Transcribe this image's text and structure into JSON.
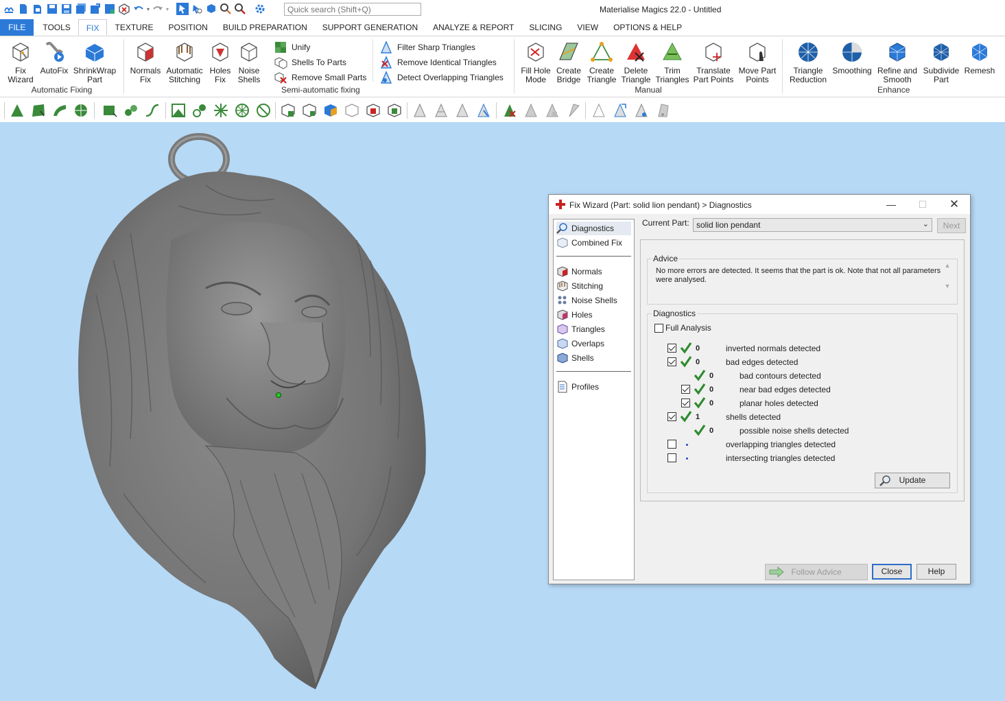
{
  "app": {
    "title": "Materialise Magics 22.0 - Untitled",
    "quick_search_placeholder": "Quick search (Shift+Q)"
  },
  "menu": {
    "tabs": [
      "FILE",
      "TOOLS",
      "FIX",
      "TEXTURE",
      "POSITION",
      "BUILD PREPARATION",
      "SUPPORT GENERATION",
      "ANALYZE & REPORT",
      "SLICING",
      "VIEW",
      "OPTIONS & HELP"
    ],
    "active": "FIX"
  },
  "ribbon": {
    "automatic_fixing": {
      "label": "Automatic Fixing",
      "fix_wizard": [
        "Fix",
        "Wizard"
      ],
      "autofix": "AutoFix",
      "shrinkwrap": [
        "ShrinkWrap",
        "Part"
      ]
    },
    "semi": {
      "label": "Semi-automatic fixing",
      "normals_fix": [
        "Normals",
        "Fix"
      ],
      "auto_stitch": [
        "Automatic",
        "Stitching"
      ],
      "holes_fix": [
        "Holes",
        "Fix"
      ],
      "noise_shells": [
        "Noise",
        "Shells"
      ],
      "unify": "Unify",
      "shells_to_parts": "Shells To Parts",
      "remove_small_parts": "Remove Small Parts",
      "filter_sharp": "Filter Sharp Triangles",
      "remove_identical": "Remove Identical Triangles",
      "detect_overlapping": "Detect Overlapping Triangles"
    },
    "manual": {
      "label": "Manual",
      "fill_hole": [
        "Fill Hole",
        "Mode"
      ],
      "create_bridge": [
        "Create",
        "Bridge"
      ],
      "create_triangle": [
        "Create",
        "Triangle"
      ],
      "delete_triangle": [
        "Delete",
        "Triangle"
      ],
      "trim_triangles": [
        "Trim",
        "Triangles"
      ],
      "translate_points": [
        "Translate",
        "Part Points"
      ],
      "move_points": [
        "Move Part",
        "Points"
      ]
    },
    "enhance": {
      "label": "Enhance",
      "triangle_reduction": [
        "Triangle",
        "Reduction"
      ],
      "smoothing": "Smoothing",
      "refine_smooth": [
        "Refine and",
        "Smooth"
      ],
      "subdivide": [
        "Subdivide",
        "Part"
      ],
      "remesh": "Remesh"
    }
  },
  "dialog": {
    "title": "Fix Wizard (Part: solid lion pendant) > Diagnostics",
    "nav": {
      "diagnostics": "Diagnostics",
      "combined_fix": "Combined Fix",
      "normals": "Normals",
      "stitching": "Stitching",
      "noise_shells": "Noise Shells",
      "holes": "Holes",
      "triangles": "Triangles",
      "overlaps": "Overlaps",
      "shells": "Shells",
      "profiles": "Profiles"
    },
    "current_part_label": "Current Part:",
    "current_part_value": "solid lion pendant",
    "next_label": "Next",
    "advice_title": "Advice",
    "advice_text": "No more errors are detected. It seems that the part is ok. Note that not all parameters were analysed.",
    "diagnostics_title": "Diagnostics",
    "full_analysis_label": "Full Analysis",
    "rows": [
      {
        "checkbox": true,
        "checked": true,
        "status": "ok",
        "count": "0",
        "label": "inverted normals detected",
        "indent": 0
      },
      {
        "checkbox": true,
        "checked": true,
        "status": "ok",
        "count": "0",
        "label": "bad edges detected",
        "indent": 0
      },
      {
        "checkbox": false,
        "checked": false,
        "status": "ok",
        "count": "0",
        "label": "bad contours detected",
        "indent": 1
      },
      {
        "checkbox": true,
        "checked": true,
        "status": "ok",
        "count": "0",
        "label": "near bad edges detected",
        "indent": 1
      },
      {
        "checkbox": true,
        "checked": true,
        "status": "ok",
        "count": "0",
        "label": "planar holes detected",
        "indent": 1
      },
      {
        "checkbox": true,
        "checked": true,
        "status": "ok",
        "count": "1",
        "label": "shells detected",
        "indent": 0
      },
      {
        "checkbox": false,
        "checked": false,
        "status": "ok",
        "count": "0",
        "label": "possible noise shells detected",
        "indent": 1
      },
      {
        "checkbox": true,
        "checked": false,
        "status": "pending",
        "count": "",
        "label": "overlapping triangles detected",
        "indent": 0
      },
      {
        "checkbox": true,
        "checked": false,
        "status": "pending",
        "count": "",
        "label": "intersecting triangles detected",
        "indent": 0
      }
    ],
    "update_label": "Update",
    "follow_advice_label": "Follow Advice",
    "close_label": "Close",
    "help_label": "Help"
  },
  "colors": {
    "accent": "#2b7ad8",
    "viewport_bg": "#b6d9f6",
    "model_gray": "#7f7f7f",
    "check_green": "#2e8b2e"
  }
}
